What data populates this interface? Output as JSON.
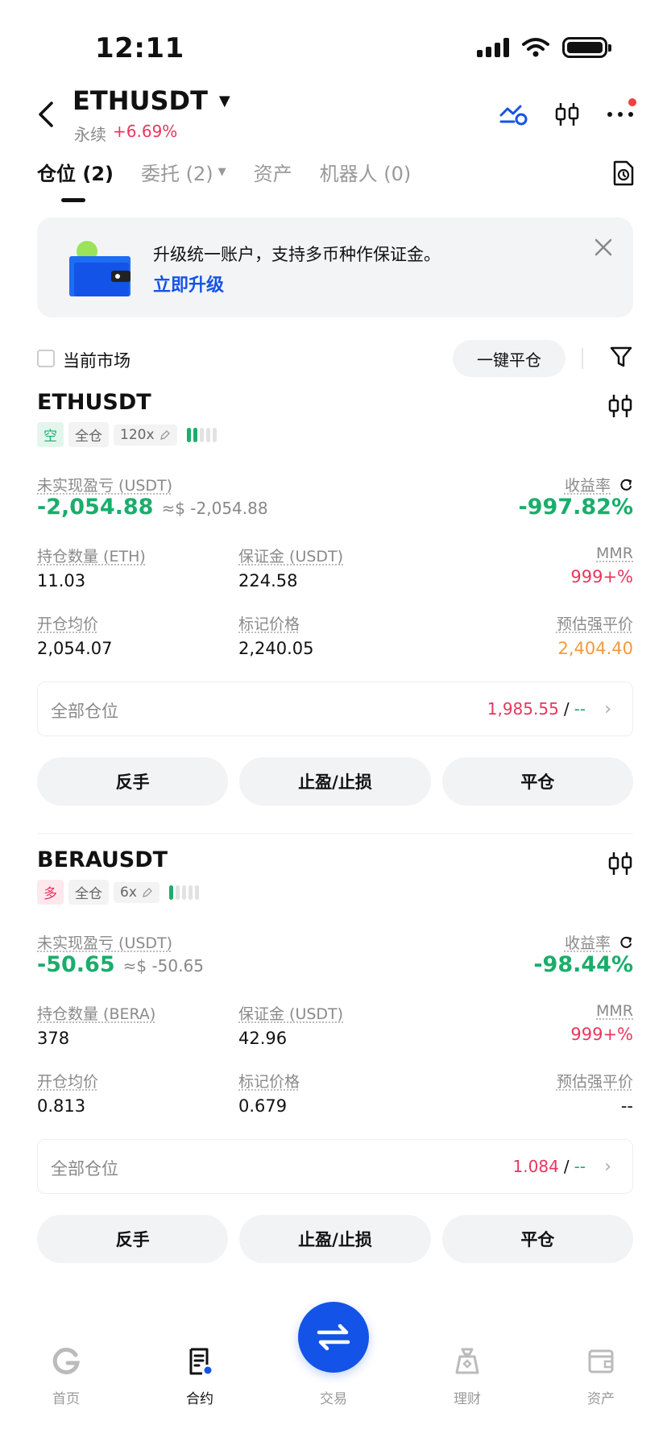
{
  "status_bar": {
    "time": "12:11"
  },
  "header": {
    "title": "ETHUSDT",
    "subtitle": "永续",
    "change": "+6.69%"
  },
  "tabs": [
    {
      "label": "仓位 (2)",
      "active": true
    },
    {
      "label": "委托 (2)",
      "active": false
    },
    {
      "label": "资产",
      "active": false
    },
    {
      "label": "机器人 (0)",
      "active": false
    }
  ],
  "banner": {
    "text": "升级统一账户，支持多币种作保证金。",
    "link": "立即升级"
  },
  "filter": {
    "current_market_label": "当前市场",
    "close_all_label": "一键平仓"
  },
  "positions": [
    {
      "symbol": "ETHUSDT",
      "side": "空",
      "margin_mode": "全仓",
      "leverage": "120x",
      "pnl_label": "未实现盈亏 (USDT)",
      "pnl": "-2,054.88",
      "pnl_approx": "≈$ -2,054.88",
      "roe_label": "收益率",
      "roe": "-997.82%",
      "size_label": "持仓数量 (ETH)",
      "size": "11.03",
      "margin_label": "保证金 (USDT)",
      "margin": "224.58",
      "mmr_label": "MMR",
      "mmr": "999+%",
      "entry_label": "开仓均价",
      "entry": "2,054.07",
      "mark_label": "标记价格",
      "mark": "2,240.05",
      "liq_label": "预估强平价",
      "liq": "2,404.40",
      "all_label": "全部仓位",
      "all_value": "1,985.55",
      "all_sep": "/",
      "all_dash": "--",
      "btn_reverse": "反手",
      "btn_tpsl": "止盈/止损",
      "btn_close": "平仓"
    },
    {
      "symbol": "BERAUSDT",
      "side": "多",
      "margin_mode": "全仓",
      "leverage": "6x",
      "pnl_label": "未实现盈亏 (USDT)",
      "pnl": "-50.65",
      "pnl_approx": "≈$ -50.65",
      "roe_label": "收益率",
      "roe": "-98.44%",
      "size_label": "持仓数量 (BERA)",
      "size": "378",
      "margin_label": "保证金 (USDT)",
      "margin": "42.96",
      "mmr_label": "MMR",
      "mmr": "999+%",
      "entry_label": "开仓均价",
      "entry": "0.813",
      "mark_label": "标记价格",
      "mark": "0.679",
      "liq_label": "预估强平价",
      "liq": "--",
      "all_label": "全部仓位",
      "all_value": "1.084",
      "all_sep": "/",
      "all_dash": "--",
      "btn_reverse": "反手",
      "btn_tpsl": "止盈/止损",
      "btn_close": "平仓"
    }
  ],
  "tabbar": {
    "home": "首页",
    "contract": "合约",
    "trade": "交易",
    "finance": "理财",
    "assets": "资产"
  },
  "colors": {
    "accent": "#1453e8",
    "profit_green": "#1aad6b",
    "loss_red": "#e8365d",
    "warning_orange": "#f39a3d"
  }
}
